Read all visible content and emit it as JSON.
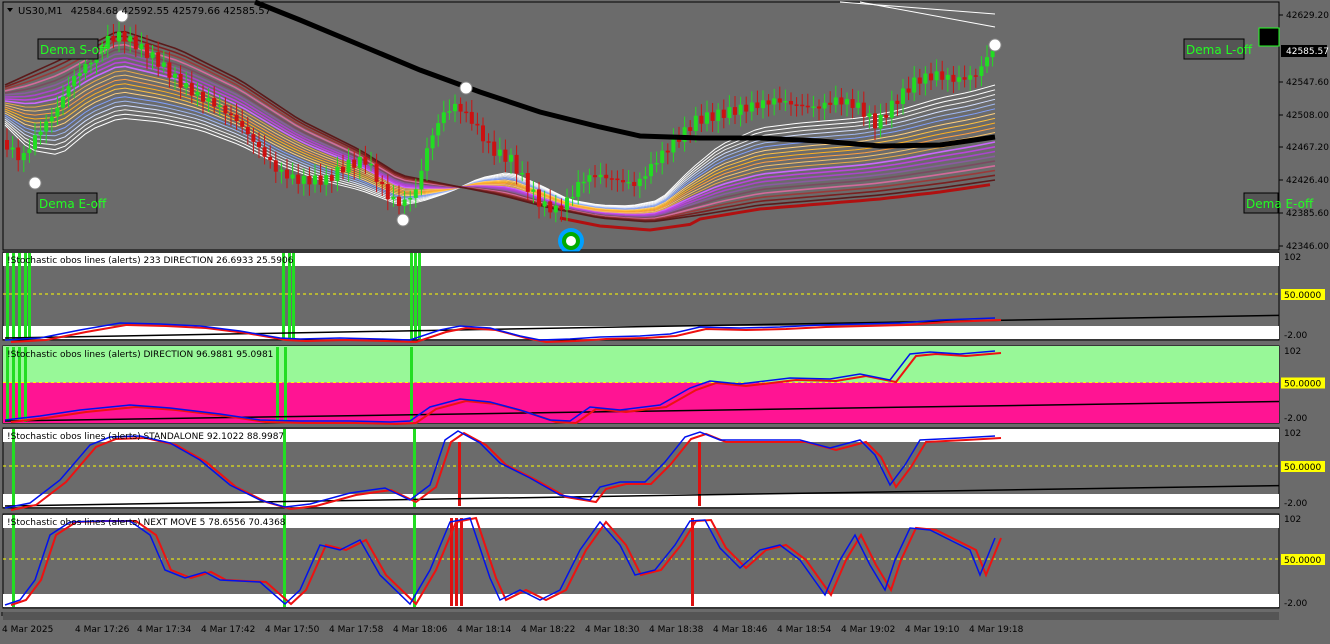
{
  "main": {
    "symbol": "US30,M1",
    "ohlc": "42584.68 42592.55 42579.66 42585.57",
    "price_axis": [
      "42629.20",
      "42585.57",
      "42547.60",
      "42508.00",
      "42467.20",
      "42426.40",
      "42385.60",
      "42346.00"
    ],
    "current_price": "42585.57",
    "labels": {
      "dema_s": "Dema S-off",
      "dema_e": "Dema E-off",
      "dema_l": "Dema L-off",
      "dema_right": "Dema E-off"
    }
  },
  "panels": [
    {
      "title": "!Stochastic obos lines (alerts) 233 DIRECTION 26.6933 25.5906",
      "levels": [
        "102",
        "50.0000",
        "-2.00"
      ]
    },
    {
      "title": "!Stochastic obos lines (alerts) DIRECTION 96.9881 95.0981",
      "levels": [
        "102",
        "50.0000",
        "-2.00"
      ]
    },
    {
      "title": "!Stochastic obos lines (alerts) STANDALONE 92.1022 88.9987",
      "levels": [
        "102",
        "50.0000",
        "-2.00"
      ]
    },
    {
      "title": "!Stochastic obos lines (alerts) NEXT MOVE 5 78.6556 70.4368",
      "levels": [
        "102",
        "50.0000",
        "-2.00"
      ]
    }
  ],
  "time_axis": [
    "4 Mar 2025",
    "4 Mar 17:26",
    "4 Mar 17:34",
    "4 Mar 17:42",
    "4 Mar 17:50",
    "4 Mar 17:58",
    "4 Mar 18:06",
    "4 Mar 18:14",
    "4 Mar 18:22",
    "4 Mar 18:30",
    "4 Mar 18:38",
    "4 Mar 18:46",
    "4 Mar 18:54",
    "4 Mar 19:02",
    "4 Mar 19:10",
    "4 Mar 19:18"
  ],
  "colors": {
    "bg": "#6b6b6b",
    "bull": "#22dd22",
    "bear": "#cc1111",
    "ma_black": "#000000",
    "stoch_k": "#0011ee",
    "stoch_d": "#ee1111",
    "level": "#ffff00",
    "pink": "#ff1493",
    "green_zone": "#98f898"
  }
}
